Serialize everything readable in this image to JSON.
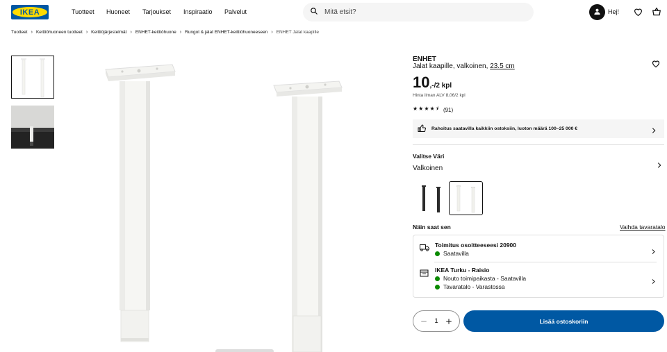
{
  "header": {
    "logo_text": "IKEA",
    "nav": [
      "Tuotteet",
      "Huoneet",
      "Tarjoukset",
      "Inspiraatio",
      "Palvelut"
    ],
    "search_placeholder": "Mitä etsit?",
    "user_greeting": "Hej!",
    "icons": {
      "search": "search-icon",
      "user": "user-icon",
      "favourites": "heart-icon",
      "cart": "shopping-bag-icon"
    }
  },
  "breadcrumb": {
    "items": [
      "Tuotteet",
      "Keittiöhuoneen tuotteet",
      "Keittiöjärjestelmät",
      "ENHET-keittiöhuone",
      "Rungot & jalat ENHET-keittiöhuoneeseen",
      "ENHET Jalat kaapille"
    ]
  },
  "product": {
    "name": "ENHET",
    "description": "Jalat kaapille, valkoinen,",
    "measure": "23.5 cm",
    "price_main": "10",
    "price_suffix": ",-/2 kpl",
    "vat_note": "Hinta ilman ALV 8,06/2 kpl",
    "rating_value": 4.5,
    "rating_count": "(91)",
    "finance_text": "Rahoitus saatavilla kaikkiin ostoksiin, luoton määrä 100–25 000 €",
    "color_label": "Valitse Väri",
    "color_value": "Valkoinen",
    "swatches": [
      {
        "name": "black",
        "color": "#2b2b2b"
      },
      {
        "name": "white",
        "color": "#f4f4ef",
        "selected": true
      }
    ]
  },
  "availability": {
    "title": "Näin saat sen",
    "change_store": "Vaihda tavaratalo",
    "delivery": {
      "title": "Toimitus osoitteeseesi 20900",
      "status": "Saatavilla"
    },
    "store": {
      "title": "IKEA Turku - Raisio",
      "pickup": "Nouto toimipaikasta - Saatavilla",
      "instore": "Tavaratalo - Varastossa"
    },
    "status_color": "#0a8a00"
  },
  "purchase": {
    "quantity": "1",
    "add_to_cart": "Lisää ostoskoriin",
    "accent": "#0058a3"
  }
}
